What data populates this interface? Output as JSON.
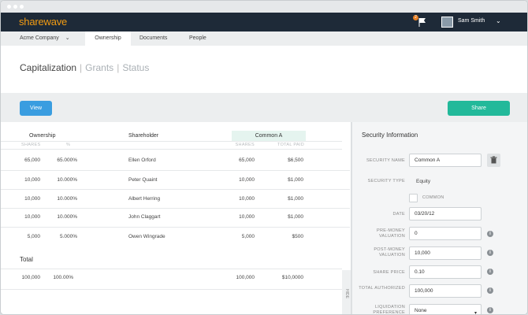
{
  "app": {
    "brand": "sharewave",
    "notification_count": "2",
    "user_name": "Sam Smith"
  },
  "subnav": {
    "company": "Acme Company",
    "tabs": [
      "Ownership",
      "Documents",
      "People"
    ],
    "active": "Ownership"
  },
  "page": {
    "title": "Capitalization",
    "tabs": [
      "Grants",
      "Status"
    ]
  },
  "toolbar": {
    "view_label": "View",
    "share_label": "Share"
  },
  "table": {
    "group_headers": {
      "ownership": "Ownership",
      "shareholder": "Shareholder",
      "common": "Common A"
    },
    "sub_headers": {
      "shares": "SHARES",
      "percent": "%",
      "shares2": "SHARES",
      "total_paid": "TOTAL PAID"
    },
    "rows": [
      {
        "shares": "65,000",
        "pct": "65.000%",
        "name": "Ellen Orford",
        "c_shares": "65,000",
        "paid": "$6,500"
      },
      {
        "shares": "10,000",
        "pct": "10.000%",
        "name": "Peter Quaint",
        "c_shares": "10,000",
        "paid": "$1,000"
      },
      {
        "shares": "10,000",
        "pct": "10.000%",
        "name": "Albert Herring",
        "c_shares": "10,000",
        "paid": "$1,000"
      },
      {
        "shares": "10,000",
        "pct": "10.000%",
        "name": "John Claggart",
        "c_shares": "10,000",
        "paid": "$1,000"
      },
      {
        "shares": "5,000",
        "pct": "5.000%",
        "name": "Owen Wingrade",
        "c_shares": "5,000",
        "paid": "$500"
      }
    ],
    "total": {
      "label": "Total",
      "shares": "100,000",
      "pct": "100.00%",
      "c_shares": "100,000",
      "paid": "$10,0000"
    },
    "hide_label": "HIDE"
  },
  "security": {
    "title": "Security Information",
    "labels": {
      "name": "SECURITY NAME",
      "type": "SECURITY TYPE",
      "common": "COMMON",
      "date": "DATE",
      "premoney": "PRE-MONEY VALUATION",
      "postmoney": "POST-MONEY VALUATION",
      "price": "SHARE PRICE",
      "authorized": "TOTAL AUTHORIZED",
      "liquidation": "LIQUIDATION PREFERENCE"
    },
    "values": {
      "name": "Common A",
      "type": "Equity",
      "date": "03/20/12",
      "premoney": "0",
      "postmoney": "10,000",
      "price": "0.10",
      "authorized": "100,000",
      "liquidation": "None"
    }
  }
}
